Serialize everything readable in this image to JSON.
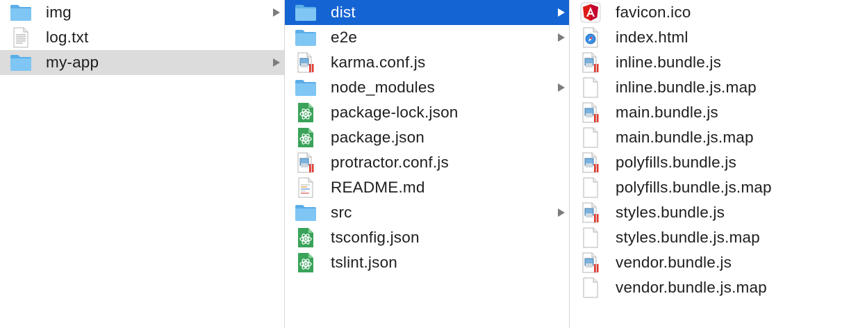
{
  "columns": [
    {
      "items": [
        {
          "name": "img",
          "kind": "folder",
          "icon": "folder-icon",
          "has_children": true,
          "state": "none"
        },
        {
          "name": "log.txt",
          "kind": "text",
          "icon": "text-file-icon",
          "has_children": false,
          "state": "none"
        },
        {
          "name": "my-app",
          "kind": "folder",
          "icon": "folder-icon",
          "has_children": true,
          "state": "selected-inactive"
        }
      ]
    },
    {
      "items": [
        {
          "name": "dist",
          "kind": "folder",
          "icon": "folder-icon",
          "has_children": true,
          "state": "selected-active"
        },
        {
          "name": "e2e",
          "kind": "folder",
          "icon": "folder-icon",
          "has_children": true,
          "state": "none"
        },
        {
          "name": "karma.conf.js",
          "kind": "js",
          "icon": "js-file-icon",
          "has_children": false,
          "state": "none"
        },
        {
          "name": "node_modules",
          "kind": "folder",
          "icon": "folder-icon",
          "has_children": true,
          "state": "none"
        },
        {
          "name": "package-lock.json",
          "kind": "json",
          "icon": "atom-json-file-icon",
          "has_children": false,
          "state": "none"
        },
        {
          "name": "package.json",
          "kind": "json",
          "icon": "atom-json-file-icon",
          "has_children": false,
          "state": "none"
        },
        {
          "name": "protractor.conf.js",
          "kind": "js",
          "icon": "js-file-icon",
          "has_children": false,
          "state": "none"
        },
        {
          "name": "README.md",
          "kind": "md",
          "icon": "markdown-file-icon",
          "has_children": false,
          "state": "none"
        },
        {
          "name": "src",
          "kind": "folder",
          "icon": "folder-icon",
          "has_children": true,
          "state": "none"
        },
        {
          "name": "tsconfig.json",
          "kind": "json",
          "icon": "atom-json-file-icon",
          "has_children": false,
          "state": "none"
        },
        {
          "name": "tslint.json",
          "kind": "json",
          "icon": "atom-json-file-icon",
          "has_children": false,
          "state": "none"
        }
      ]
    },
    {
      "items": [
        {
          "name": "favicon.ico",
          "kind": "angular",
          "icon": "angular-icon",
          "has_children": false,
          "state": "none"
        },
        {
          "name": "index.html",
          "kind": "html",
          "icon": "safari-html-file-icon",
          "has_children": false,
          "state": "none"
        },
        {
          "name": "inline.bundle.js",
          "kind": "js",
          "icon": "js-file-icon",
          "has_children": false,
          "state": "none"
        },
        {
          "name": "inline.bundle.js.map",
          "kind": "blank",
          "icon": "blank-file-icon",
          "has_children": false,
          "state": "none"
        },
        {
          "name": "main.bundle.js",
          "kind": "js",
          "icon": "js-file-icon",
          "has_children": false,
          "state": "none"
        },
        {
          "name": "main.bundle.js.map",
          "kind": "blank",
          "icon": "blank-file-icon",
          "has_children": false,
          "state": "none"
        },
        {
          "name": "polyfills.bundle.js",
          "kind": "js",
          "icon": "js-file-icon",
          "has_children": false,
          "state": "none"
        },
        {
          "name": "polyfills.bundle.js.map",
          "kind": "blank",
          "icon": "blank-file-icon",
          "has_children": false,
          "state": "none"
        },
        {
          "name": "styles.bundle.js",
          "kind": "js",
          "icon": "js-file-icon",
          "has_children": false,
          "state": "none"
        },
        {
          "name": "styles.bundle.js.map",
          "kind": "blank",
          "icon": "blank-file-icon",
          "has_children": false,
          "state": "none"
        },
        {
          "name": "vendor.bundle.js",
          "kind": "js",
          "icon": "js-file-icon",
          "has_children": false,
          "state": "none"
        },
        {
          "name": "vendor.bundle.js.map",
          "kind": "blank",
          "icon": "blank-file-icon",
          "has_children": false,
          "state": "none"
        }
      ]
    }
  ],
  "colors": {
    "selection_active": "#1564d3",
    "selection_inactive": "#dcdcdc",
    "folder": "#6bbcf0",
    "json_icon": "#3aa35a",
    "angular": "#dd1b16"
  }
}
